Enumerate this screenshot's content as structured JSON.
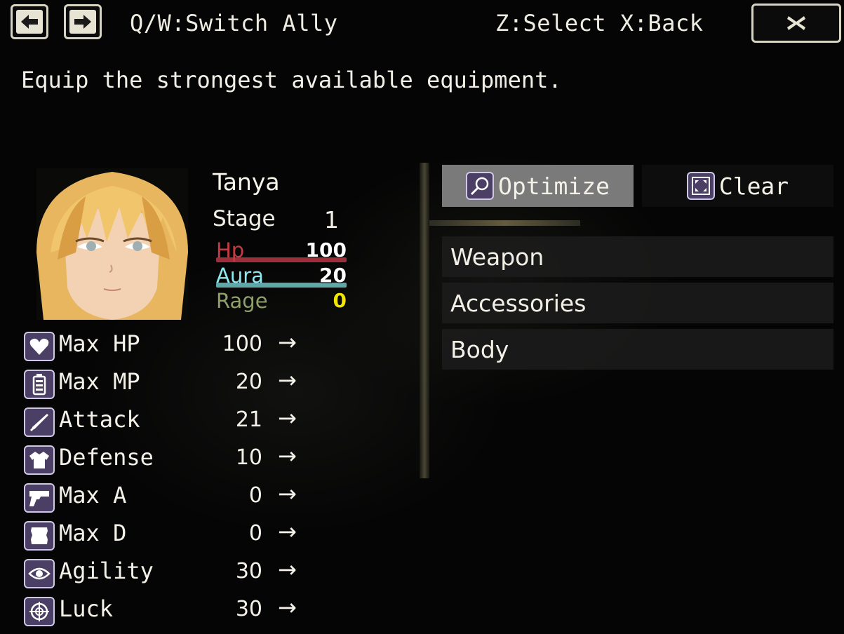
{
  "topbar": {
    "back_icon": "arrow-left-icon",
    "forward_icon": "arrow-right-icon",
    "switch_hint": "Q/W:Switch Ally",
    "select_hint": "Z:Select X:Back",
    "close_icon": "close-icon"
  },
  "help": {
    "text": "Equip the strongest available equipment."
  },
  "actor": {
    "name": "Tanya",
    "stage_label": "Stage",
    "stage_value": "1",
    "gauges": [
      {
        "label": "Hp",
        "value": "100",
        "fill": 1.0,
        "label_color": "#c23b45",
        "bar_color": "#9c2f3a",
        "value_color": "#ffffff"
      },
      {
        "label": "Aura",
        "value": "20",
        "fill": 1.0,
        "label_color": "#8ee8ee",
        "bar_color": "#5ea9a8",
        "value_color": "#ffffff"
      },
      {
        "label": "Rage",
        "value": "0",
        "fill": 0.0,
        "label_color": "#8fa06a",
        "bar_color": "#6b7a3d",
        "value_color": "#f2e600"
      }
    ]
  },
  "params": [
    {
      "name": "Max HP",
      "value": "100",
      "arrow": "→",
      "icon": "heart-icon"
    },
    {
      "name": "Max MP",
      "value": "20",
      "arrow": "→",
      "icon": "battery-icon"
    },
    {
      "name": "Attack",
      "value": "21",
      "arrow": "→",
      "icon": "sword-icon"
    },
    {
      "name": "Defense",
      "value": "10",
      "arrow": "→",
      "icon": "armor-icon"
    },
    {
      "name": "Max A",
      "value": "0",
      "arrow": "→",
      "icon": "gun-icon"
    },
    {
      "name": "Max D",
      "value": "0",
      "arrow": "→",
      "icon": "scroll-icon"
    },
    {
      "name": "Agility",
      "value": "30",
      "arrow": "→",
      "icon": "eye-icon"
    },
    {
      "name": "Luck",
      "value": "30",
      "arrow": "→",
      "icon": "target-icon"
    }
  ],
  "commands": {
    "optimize": {
      "label": "Optimize",
      "icon": "magnifier-icon"
    },
    "clear": {
      "label": "Clear",
      "icon": "expand-icon"
    }
  },
  "slots": [
    {
      "label": "Weapon"
    },
    {
      "label": "Accessories"
    },
    {
      "label": "Body"
    }
  ],
  "colors": {
    "accent": "#e8e4d4",
    "icon_bg": "#4b3f66",
    "selected_cmd": "#7a7a7a"
  }
}
